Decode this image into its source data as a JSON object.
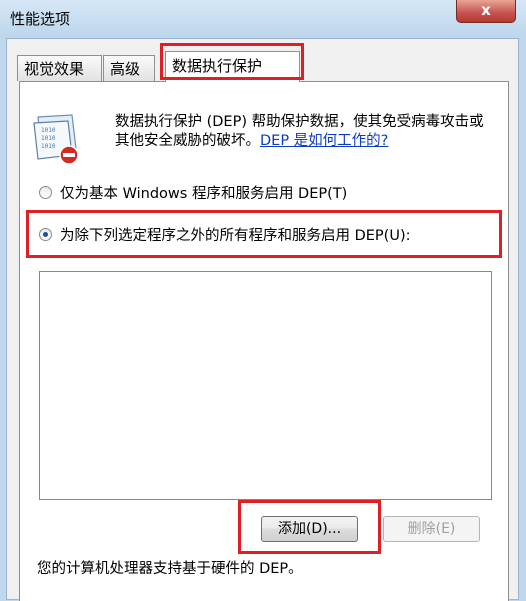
{
  "window": {
    "title": "性能选项",
    "close_label": "x"
  },
  "tabs": [
    {
      "label": "视觉效果"
    },
    {
      "label": "高级"
    },
    {
      "label": "数据执行保护"
    }
  ],
  "dep": {
    "description": "数据执行保护 (DEP) 帮助保护数据，使其免受病毒攻击或其他安全威胁的破坏。",
    "help_link": "DEP 是如何工作的?",
    "icon": "dep-shield-icon",
    "icon_text": "1010"
  },
  "options": {
    "essential_only": {
      "label": "仅为基本 Windows 程序和服务启用 DEP(T)",
      "checked": false
    },
    "all_except": {
      "label": "为除下列选定程序之外的所有程序和服务启用 DEP(U):",
      "checked": true
    }
  },
  "program_list": [],
  "buttons": {
    "add": "添加(D)...",
    "remove": "删除(E)"
  },
  "footer": "您的计算机处理器支持基于硬件的 DEP。",
  "colors": {
    "highlight": "#e01f25",
    "link": "#0b3cc5",
    "close": "#c75050"
  }
}
